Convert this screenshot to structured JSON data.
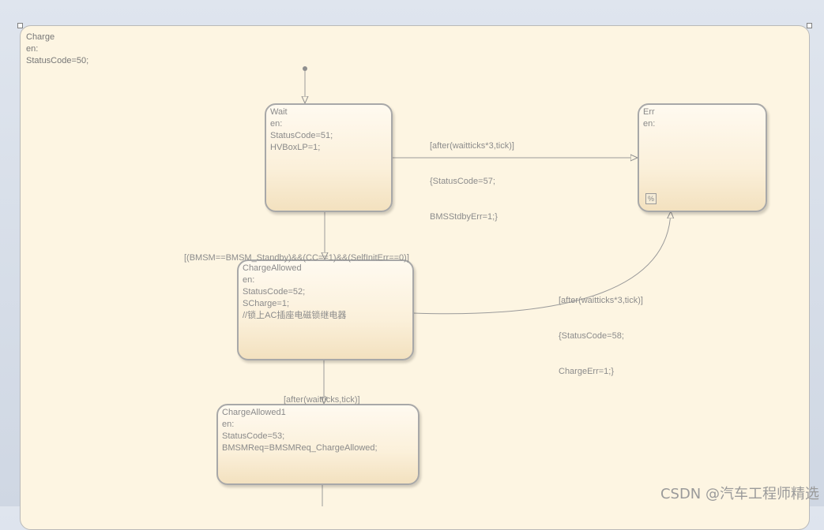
{
  "superstate": {
    "name": "Charge",
    "lines": [
      "en:",
      "StatusCode=50;"
    ]
  },
  "states": {
    "wait": {
      "name": "Wait",
      "lines": [
        "en:",
        "StatusCode=51;",
        "HVBoxLP=1;"
      ]
    },
    "err": {
      "name": "Err",
      "lines": [
        "en:"
      ],
      "history_glyph": "%"
    },
    "charge_allowed": {
      "name": "ChargeAllowed",
      "lines": [
        "en:",
        "StatusCode=52;",
        "SCharge=1;",
        "//锁上AC插座电磁锁继电器"
      ]
    },
    "charge_allowed1": {
      "name": "ChargeAllowed1",
      "lines": [
        "en:",
        "StatusCode=53;",
        "BMSMReq=BMSMReq_ChargeAllowed;"
      ]
    }
  },
  "transitions": {
    "wait_to_err": [
      "[after(waitticks*3,tick)]",
      "{StatusCode=57;",
      "BMSStdbyErr=1;}"
    ],
    "wait_to_allowed": [
      "[(BMSM==BMSM_Standby)&&(CC==1)&&(SelfInitErr==0)]"
    ],
    "allowed_to_err": [
      "[after(waitticks*3,tick)]",
      "{StatusCode=58;",
      "ChargeErr=1;}"
    ],
    "allowed_to_allowed1": [
      "[after(waitticks,tick)]"
    ]
  },
  "watermark": "CSDN @汽车工程师精选"
}
